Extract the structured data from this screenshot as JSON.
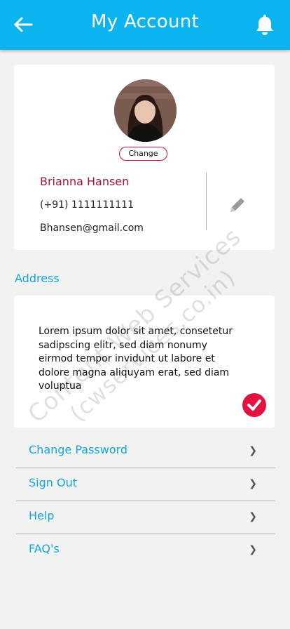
{
  "header": {
    "title": "My Account",
    "back_icon": "arrow-left-icon",
    "bell_icon": "bell-icon",
    "background_color": "#0bb4ef"
  },
  "profile": {
    "avatar_icon": "user-photo",
    "change_label": "Change",
    "name": "Brianna Hansen",
    "phone": "(+91) 1111111111",
    "email": "Bhansen@gmail.com",
    "edit_icon": "pencil-icon"
  },
  "address": {
    "label": "Address",
    "text": "Lorem ipsum dolor sit amet, consetetur sadipscing elitr, sed diam nonumy eirmod tempor invidunt ut labore et dolore magna aliquyam erat, sed diam voluptua",
    "confirm_icon": "checkmark-icon"
  },
  "menu": {
    "items": [
      {
        "label": "Change Password",
        "chevron": "❯"
      },
      {
        "label": "Sign Out",
        "chevron": "❯"
      },
      {
        "label": "Help",
        "chevron": "❯"
      },
      {
        "label": "FAQ's",
        "chevron": "❯"
      }
    ]
  },
  "watermark": {
    "line1": "Content Web Services",
    "line2": "(cwservices.co.in)"
  },
  "colors": {
    "accent": "#12a8dd",
    "name": "#a3173b",
    "check": "#e3123f"
  }
}
